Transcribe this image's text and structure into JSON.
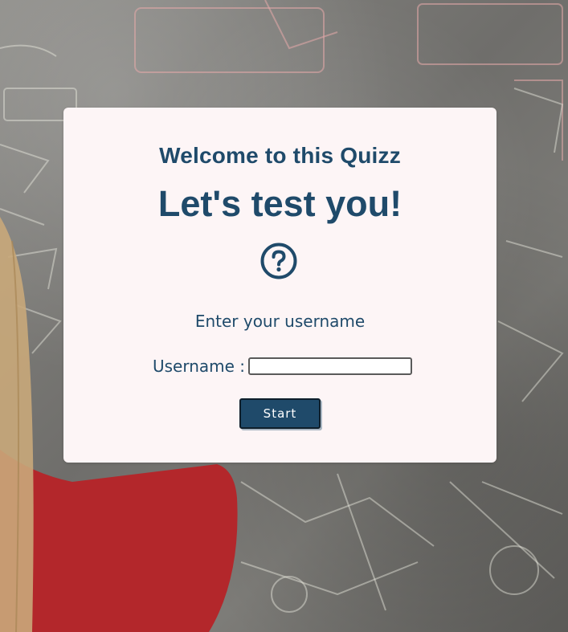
{
  "card": {
    "subtitle": "Welcome to this Quizz",
    "title": "Let's test you!",
    "icon": "question-circle-icon",
    "prompt": "Enter your username",
    "username_label": "Username :",
    "username_value": "",
    "start_label": "Start"
  },
  "colors": {
    "primary": "#1f4a6a",
    "card_background": "#fdf5f6",
    "button_text": "#ffffff"
  }
}
